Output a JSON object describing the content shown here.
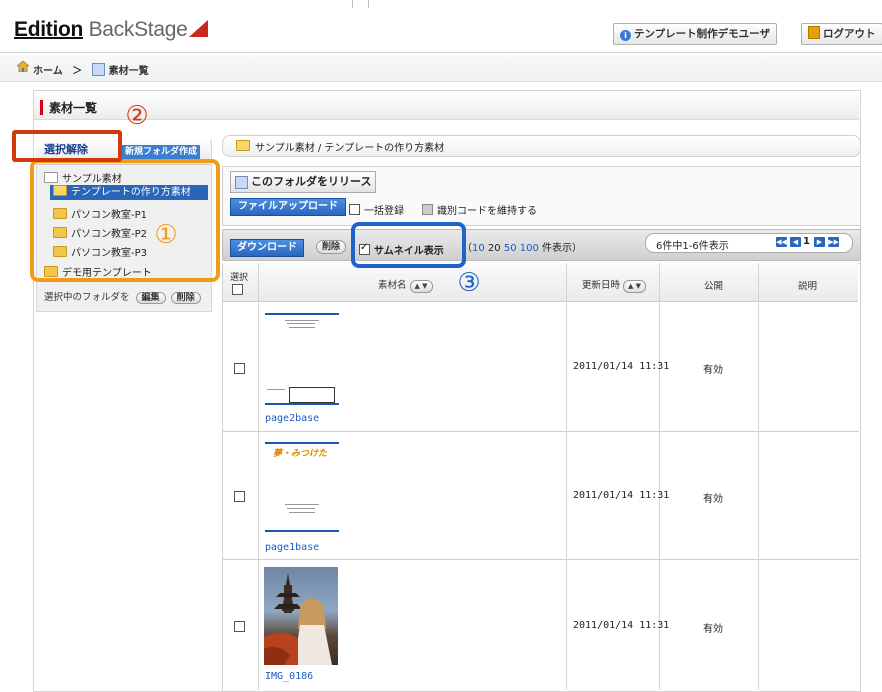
{
  "header": {
    "logo_text_1": "Edition",
    "logo_text_2": " BackStage",
    "user_label": "テンプレート制作デモユーザ",
    "logout_label": "ログアウト"
  },
  "breadcrumb": {
    "home": "ホーム",
    "sep": "＞",
    "current": "素材一覧"
  },
  "page": {
    "title": "素材一覧"
  },
  "sidebar": {
    "release_label": "選択解除",
    "new_folder_label": "新規フォルダ作成",
    "tree": [
      {
        "label": "サンプル素材"
      },
      {
        "label": "テンプレートの作り方素材"
      },
      {
        "label": "パソコン教室-P1"
      },
      {
        "label": "パソコン教室-P2"
      },
      {
        "label": "パソコン教室-P3"
      },
      {
        "label": "デモ用テンプレート"
      }
    ],
    "selected_folder_label": "選択中のフォルダを",
    "edit_label": "編集",
    "delete_label": "削除"
  },
  "main": {
    "path": "サンプル素材 / テンプレートの作り方素材",
    "release_folder_label": "このフォルダをリリース",
    "upload_label": "ファイルアップロード",
    "bulk_label": "一括登録",
    "keep_code_label": "識別コードを維持する",
    "download_label": "ダウンロード",
    "delete_label": "削除",
    "thumb_label": "サムネイル表示",
    "perpage_open": "（",
    "perpage_10": "10",
    "perpage_20": "20",
    "perpage_50": "50",
    "perpage_100": "100",
    "perpage_close": " 件表示）",
    "count_text": "6件中1-6件表示",
    "page_num": "1",
    "columns": {
      "select": "選択",
      "name": "素材名",
      "updated": "更新日時",
      "public": "公開",
      "desc": "説明"
    },
    "rows": [
      {
        "name": "page2base",
        "updated": "2011/01/14 11:31",
        "status": "有効"
      },
      {
        "name": "page1base",
        "updated": "2011/01/14 11:31",
        "status": "有効"
      },
      {
        "name": "IMG_0186",
        "updated": "2011/01/14 11:31",
        "status": "有効"
      }
    ],
    "thumb2_caption": "夢・みつけた"
  },
  "annotations": {
    "n1": "①",
    "n2": "②",
    "n3": "③"
  },
  "colors": {
    "accent_blue": "#2a66c0",
    "brand_red": "#c8281e",
    "ann_orange": "#f29a1a",
    "ann_red": "#d23a0e",
    "ann_blue": "#1f62c8"
  }
}
